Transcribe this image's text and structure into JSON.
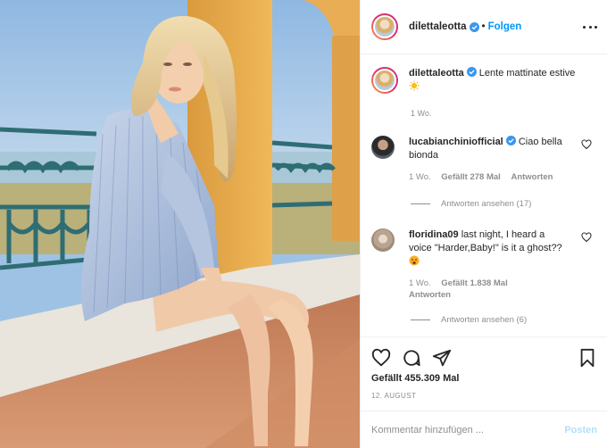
{
  "photo": {
    "alt_name": "post-photo"
  },
  "header": {
    "username": "dilettaleotta",
    "dot": "•",
    "follow_label": "Folgen"
  },
  "caption": {
    "username": "dilettaleotta",
    "text": "Lente mattinate estive",
    "time": "1 Wo."
  },
  "comments": [
    {
      "username": "lucabianchiniofficial",
      "text": "Ciao bella bionda",
      "time": "1 Wo.",
      "likes": "Gefällt 278 Mal",
      "reply_label": "Antworten",
      "view_replies": "Antworten ansehen (17)"
    },
    {
      "username": "floridina09",
      "text": "last night, I heard a voice \"Harder,Baby!\" is it a ghost??",
      "time": "1 Wo.",
      "likes": "Gefällt 1.838 Mal",
      "reply_label": "Antworten",
      "view_replies": "Antworten ansehen (6)"
    }
  ],
  "stats": {
    "likes": "Gefällt 455.309 Mal",
    "date": "12. AUGUST"
  },
  "composer": {
    "placeholder": "Kommentar hinzufügen ...",
    "post_label": "Posten"
  },
  "colors": {
    "accent": "#0095f6",
    "muted": "#8e8e8e",
    "border": "#efefef"
  }
}
